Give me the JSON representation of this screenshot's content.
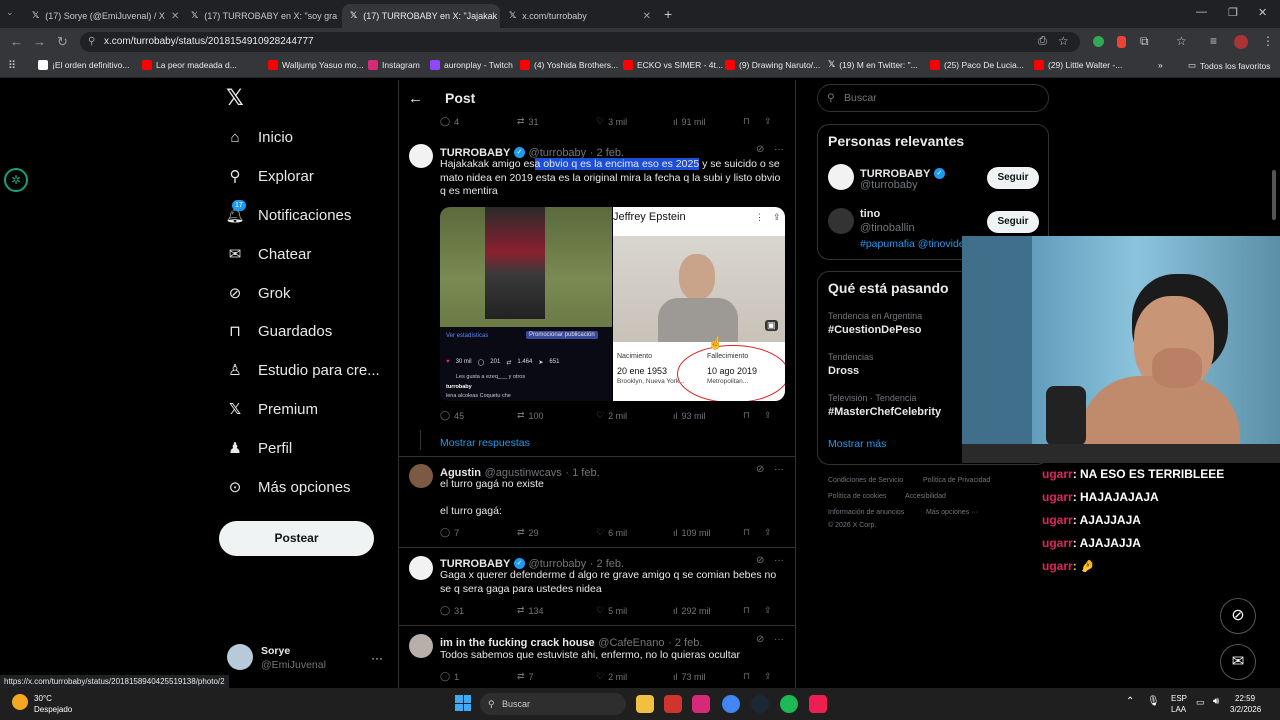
{
  "browser": {
    "tabs": [
      {
        "label": "(17) Sorye (@EmiJuvenal) / X"
      },
      {
        "label": "(17) TURROBABY en X: \"soy gra"
      },
      {
        "label": "(17) TURROBABY en X: \"Jajakak"
      },
      {
        "label": "x.com/turrobaby"
      }
    ],
    "url": "x.com/turrobaby/status/2018154910928244777",
    "bookmarks": [
      {
        "label": "¡El orden definitivo..."
      },
      {
        "label": "La peor madeada d..."
      },
      {
        "label": "Walljump Yasuo mo..."
      },
      {
        "label": "Instagram"
      },
      {
        "label": "auronplay - Twitch"
      },
      {
        "label": "(4) Yoshida Brothers..."
      },
      {
        "label": "ECKO vs SIMER - 4t..."
      },
      {
        "label": "(9) Drawing Naruto/..."
      },
      {
        "label": "(19) M en Twitter: \"..."
      },
      {
        "label": "(25) Paco De Lucia..."
      },
      {
        "label": "(29) Little Walter -..."
      }
    ],
    "bookmarks_all": "Todos los favoritos",
    "status_url": "https://x.com/turrobaby/status/2018158940425519138/photo/2"
  },
  "sidebar": {
    "items": [
      {
        "label": "Inicio"
      },
      {
        "label": "Explorar"
      },
      {
        "label": "Notificaciones",
        "badge": "17"
      },
      {
        "label": "Chatear"
      },
      {
        "label": "Grok"
      },
      {
        "label": "Guardados"
      },
      {
        "label": "Estudio para cre..."
      },
      {
        "label": "Premium"
      },
      {
        "label": "Perfil"
      },
      {
        "label": "Más opciones"
      }
    ],
    "post_button": "Postear",
    "user": {
      "name": "Sorye",
      "handle": "@EmiJuvenal"
    }
  },
  "feed": {
    "title": "Post",
    "top_stats": {
      "replies": "4",
      "reposts": "31",
      "likes": "3 mil",
      "views": "91 mil"
    },
    "tweets": [
      {
        "name": "TURROBABY",
        "handle": "@turrobaby",
        "date": "· 2 feb.",
        "text_before": "Hajakakak amigo es",
        "text_highlight": "a obvio q es la encima eso es 2025",
        "text_after": " y se suicido o se mato nidea en 2019 esta es la original mira la fecha q la subi y listo obvio q es mentira",
        "media": {
          "left": {
            "link1": "Ver estadísticas",
            "link2": "Promocionar publicación",
            "likes": "30 mil",
            "comments": "201",
            "reposts": "1.464",
            "shares": "651",
            "liked_by": "Les gusta a ezeq___ y otros",
            "owner": "turrobaby",
            "caption": "lena alcoleas Coquetu che"
          },
          "right": {
            "title": "Jeffrey Epstein",
            "birth_label": "Nacimiento",
            "birth_date": "20 ene 1953",
            "birth_place": "Brooklyn, Nueva York...",
            "death_label": "Fallecimiento",
            "death_date": "10 ago 2019",
            "death_place": "Metropolitan..."
          }
        },
        "stats": {
          "replies": "45",
          "reposts": "100",
          "likes": "2 mil",
          "views": "93 mil"
        }
      },
      {
        "name": "Agustin",
        "handle": "@agustinwcavs",
        "date": "· 1 feb.",
        "text": "el turro gagá no existe",
        "text2": "el turro gagá:",
        "stats": {
          "replies": "7",
          "reposts": "29",
          "likes": "6 mil",
          "views": "109 mil"
        }
      },
      {
        "name": "TURROBABY",
        "handle": "@turrobaby",
        "date": "· 2 feb.",
        "text": "Gaga x querer defenderme d algo re grave amigo q se comian bebes no se q sera gaga para ustedes nidea",
        "stats": {
          "replies": "31",
          "reposts": "134",
          "likes": "5 mil",
          "views": "292 mil"
        }
      },
      {
        "name": "im in the fucking crack house",
        "handle": "@CafeEnano",
        "date": "· 2 feb.",
        "text": "Todos sabemos que estuviste ahi, enfermo, no lo quieras ocultar",
        "stats": {
          "replies": "1",
          "reposts": "7",
          "likes": "2 mil",
          "views": "73 mil"
        }
      }
    ],
    "show_replies": "Mostrar respuestas"
  },
  "right": {
    "search_placeholder": "Buscar",
    "relevant_title": "Personas relevantes",
    "people": [
      {
        "name": "TURROBABY",
        "handle": "@turrobaby",
        "follow": "Seguir"
      },
      {
        "name": "tino",
        "handle": "@tinoballin",
        "follow": "Seguir",
        "bio": "#papumafia @tinovide"
      }
    ],
    "trends_title": "Qué está pasando",
    "trends": [
      {
        "category": "Tendencia en Argentina",
        "name": "#CuestionDePeso"
      },
      {
        "category": "Tendencias",
        "name": "Dross"
      },
      {
        "category": "Televisión · Tendencia",
        "name": "#MasterChefCelebrity"
      }
    ],
    "show_more": "Mostrar más",
    "footer": [
      "Condiciones de Servicio",
      "Política de Privacidad",
      "Política de cookies",
      "Accesibilidad",
      "Información de anuncios",
      "Más opciones ···",
      "© 2026 X Corp."
    ]
  },
  "chat": [
    {
      "user": "ugarr",
      "msg": ": NA ESO ES TERRIBLEEE"
    },
    {
      "user": "ugarr",
      "msg": ": HAJAJAJAJA"
    },
    {
      "user": "ugarr",
      "msg": ": AJAJJAJA"
    },
    {
      "user": "ugarr",
      "msg": ": AJAJAJJA"
    },
    {
      "user": "ugarr",
      "msg": ": 🤌"
    }
  ],
  "taskbar": {
    "weather_temp": "30°C",
    "weather_desc": "Despejado",
    "search": "Buscar",
    "lang1": "ESP",
    "lang2": "LAA",
    "time": "22:59",
    "date": "3/2/2026"
  },
  "colors": {
    "accent": "#1d9bf0",
    "highlight": "#1d4ed8",
    "chat_user": "#e0245e"
  }
}
